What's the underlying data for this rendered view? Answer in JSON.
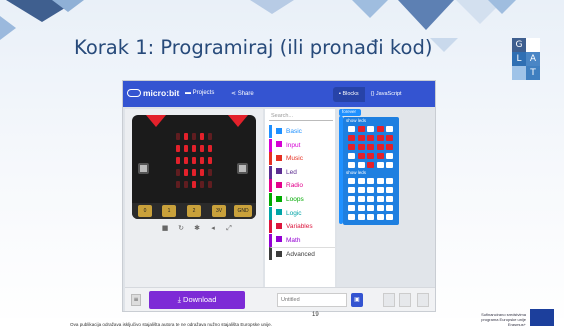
{
  "slide": {
    "title": "Korak 1: Programiraj (ili pronađi kod)",
    "page_number": "19",
    "disclaimer": "Ova publikacija odražava isključivo stajališta autora te ne odražava nužno stajališta Europske unije.",
    "eu_text": [
      "Sufinancirano sredstvima",
      "programa Europske unije",
      "Erasmus+"
    ],
    "logo_letters": [
      "G",
      "L",
      "A",
      "T"
    ]
  },
  "app": {
    "brand": "micro:bit",
    "nav": {
      "projects": "Projects",
      "share": "Share"
    },
    "tabs": {
      "blocks": "Blocks",
      "javascript": "JavaScript"
    },
    "search_placeholder": "Search...",
    "categories": [
      {
        "label": "Basic",
        "color": "#1e90ff"
      },
      {
        "label": "Input",
        "color": "#d400d4"
      },
      {
        "label": "Music",
        "color": "#e63022"
      },
      {
        "label": "Led",
        "color": "#5c2d91"
      },
      {
        "label": "Radio",
        "color": "#e3008c"
      },
      {
        "label": "Loops",
        "color": "#00aa00"
      },
      {
        "label": "Logic",
        "color": "#00a4a6"
      },
      {
        "label": "Variables",
        "color": "#dc143c"
      },
      {
        "label": "Math",
        "color": "#9400d3"
      },
      {
        "label": "Advanced",
        "color": "#3c3c3c"
      }
    ],
    "workspace": {
      "forever": "forever",
      "show_leds_1": "show leds",
      "show_leds_2": "show leds"
    },
    "pins": [
      "0",
      "1",
      "2",
      "3V",
      "GND"
    ],
    "download": "Download",
    "project_name": "Untitled",
    "accent": "#3454d1",
    "download_color": "#7d2bd6"
  }
}
